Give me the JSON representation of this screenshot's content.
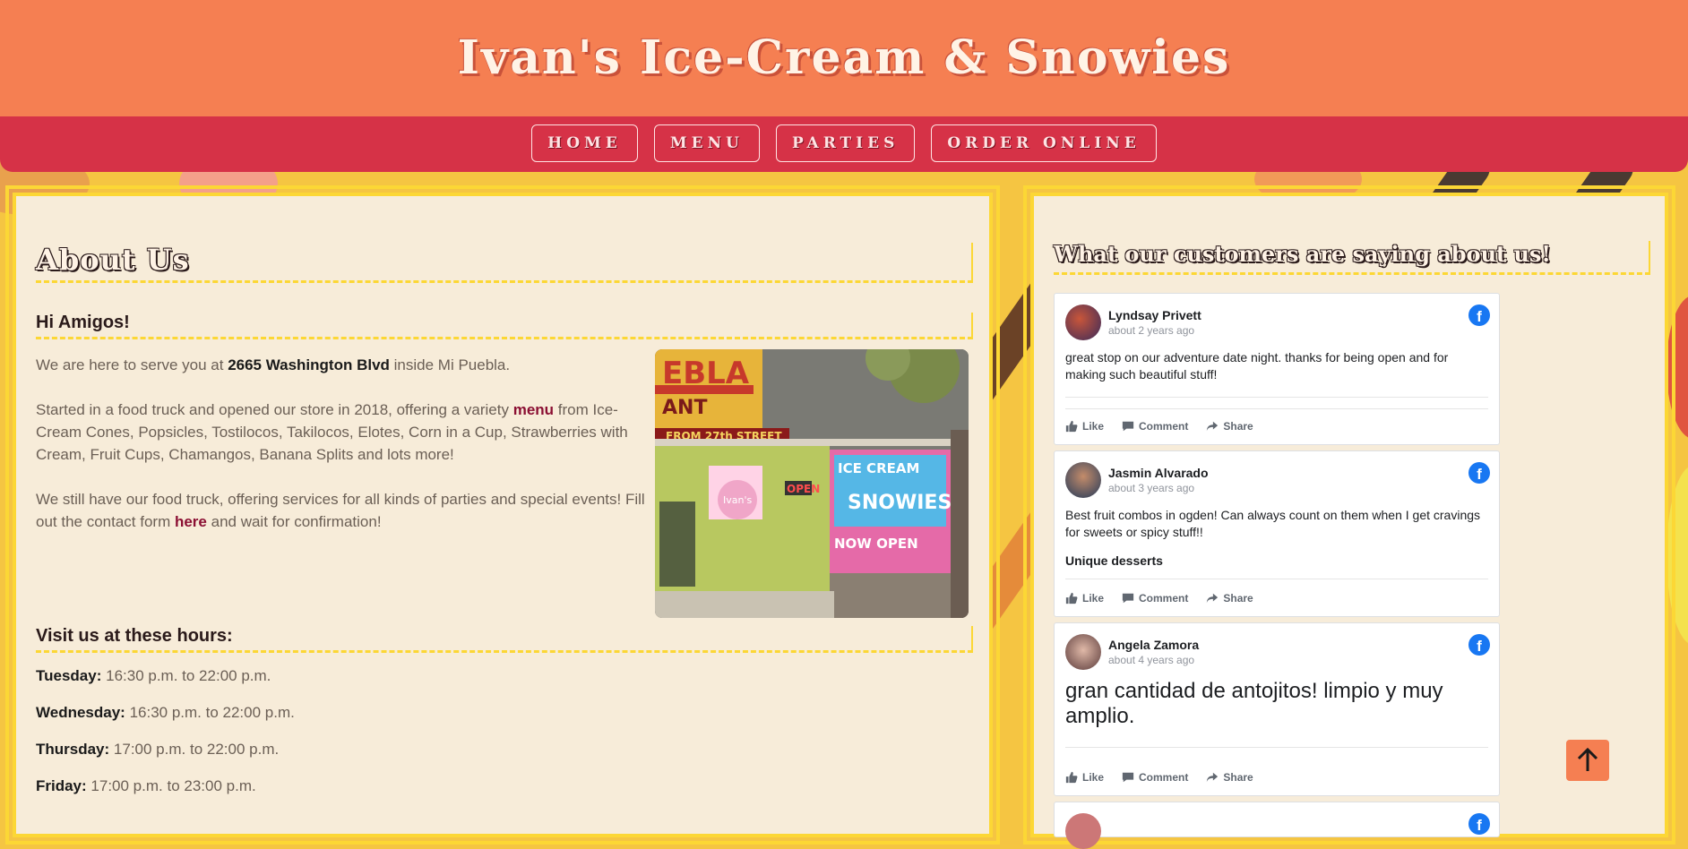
{
  "site": {
    "title": "Ivan's Ice-Cream & Snowies"
  },
  "nav": [
    {
      "label": "HOME"
    },
    {
      "label": "MENU"
    },
    {
      "label": "PARTIES"
    },
    {
      "label": "ORDER ONLINE"
    }
  ],
  "about": {
    "title": "About Us",
    "greeting": "Hi Amigos!",
    "p1_pre": "We are here to serve you at ",
    "p1_address": "2665 Washington Blvd",
    "p1_post": " inside Mi Puebla.",
    "p2_pre": "Started in a food truck and opened our store in 2018, offering a variety ",
    "p2_link": "menu",
    "p2_post": " from Ice-Cream Cones, Popsicles, Tostilocos, Takilocos, Elotes, Corn in a Cup, Strawberries with Cream, Fruit Cups, Chamangos, Banana Splits and lots more!",
    "p3_pre": "We still have our food truck, offering services for all kinds of parties and special events! Fill out the contact form ",
    "p3_link": "here",
    "p3_post": " and wait for confirmation!",
    "photo_signs": {
      "top": "EBLA",
      "sub": "ANT",
      "street": "FROM 27th STREET",
      "ice": "ICE CREAM",
      "open": "OPEN",
      "now_open": "NOW OPEN",
      "snowies": "SNOWIES",
      "logo": "Ivan's"
    }
  },
  "hours": {
    "title": "Visit us at these hours:",
    "rows": [
      {
        "day": "Tuesday:",
        "time": "16:30 p.m. to 22:00 p.m."
      },
      {
        "day": "Wednesday:",
        "time": "16:30 p.m. to 22:00 p.m."
      },
      {
        "day": "Thursday:",
        "time": "17:00 p.m. to 22:00 p.m."
      },
      {
        "day": "Friday:",
        "time": "17:00 p.m. to 23:00 p.m."
      }
    ]
  },
  "reviews": {
    "title": "What our customers are saying about us!",
    "actions": {
      "like": "Like",
      "comment": "Comment",
      "share": "Share"
    },
    "items": [
      {
        "name": "Lyndsay Privett",
        "time": "about 2 years ago",
        "text": "great stop on our adventure date night. thanks for being open and for making such beautiful stuff!",
        "tag": ""
      },
      {
        "name": "Jasmin Alvarado",
        "time": "about 3 years ago",
        "text": "Best fruit combos in ogden! Can always count on them when I get cravings for sweets or spicy stuff!!",
        "tag": "Unique desserts"
      },
      {
        "name": "Angela Zamora",
        "time": "about 4 years ago",
        "text": "gran cantidad de antojitos! limpio y muy amplio.",
        "tag": ""
      }
    ]
  },
  "colors": {
    "header": "#f57f52",
    "nav": "#d63247",
    "panel": "#f7ecd9",
    "accent": "#fcd735",
    "link": "#8b0f33",
    "facebook": "#1877f2"
  },
  "icons": {
    "scroll_top": "arrow-up-icon",
    "brand": "facebook-icon"
  }
}
